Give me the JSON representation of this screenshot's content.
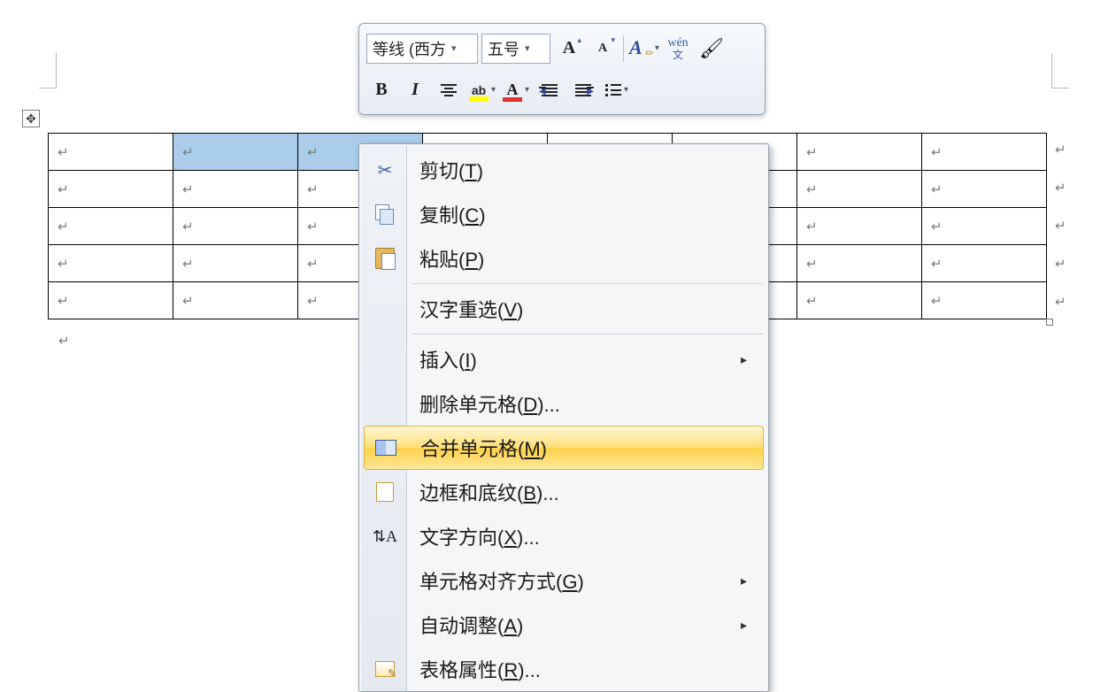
{
  "para_mark": "↵",
  "move_handle_glyph": "✥",
  "mini_toolbar": {
    "font_name": "等线 (西方",
    "font_size": "五号",
    "grow_font_tip": "A",
    "shrink_font_tip": "A",
    "style_A": "A",
    "wen_top": "wén",
    "wen_bottom": "文",
    "bold": "B",
    "italic": "I",
    "highlight_label": "ab",
    "fontcolor_label": "A"
  },
  "context_menu": {
    "items": [
      {
        "icon": "cut",
        "label_pre": "剪切(",
        "hk": "T",
        "label_post": ")"
      },
      {
        "icon": "copy",
        "label_pre": "复制(",
        "hk": "C",
        "label_post": ")"
      },
      {
        "icon": "paste",
        "label_pre": "粘贴(",
        "hk": "P",
        "label_post": ")"
      },
      {
        "sep": true
      },
      {
        "icon": "",
        "label_pre": "汉字重选(",
        "hk": "V",
        "label_post": ")"
      },
      {
        "sep": true
      },
      {
        "icon": "",
        "label_pre": "插入(",
        "hk": "I",
        "label_post": ")",
        "submenu": true
      },
      {
        "icon": "",
        "label_pre": "删除单元格(",
        "hk": "D",
        "label_post": ")..."
      },
      {
        "icon": "merge",
        "label_pre": "合并单元格(",
        "hk": "M",
        "label_post": ")",
        "hover": true
      },
      {
        "icon": "border",
        "label_pre": "边框和底纹(",
        "hk": "B",
        "label_post": ")..."
      },
      {
        "icon": "dir",
        "label_pre": "文字方向(",
        "hk": "X",
        "label_post": ")..."
      },
      {
        "icon": "",
        "label_pre": "单元格对齐方式(",
        "hk": "G",
        "label_post": ")",
        "submenu": true
      },
      {
        "icon": "",
        "label_pre": "自动调整(",
        "hk": "A",
        "label_post": ")",
        "submenu": true
      },
      {
        "icon": "prop",
        "label_pre": "表格属性(",
        "hk": "R",
        "label_post": ")..."
      }
    ],
    "submenu_arrow": "▸"
  },
  "table": {
    "rows": 5,
    "cols": 8,
    "selected_row0_cols": [
      1,
      2
    ]
  }
}
